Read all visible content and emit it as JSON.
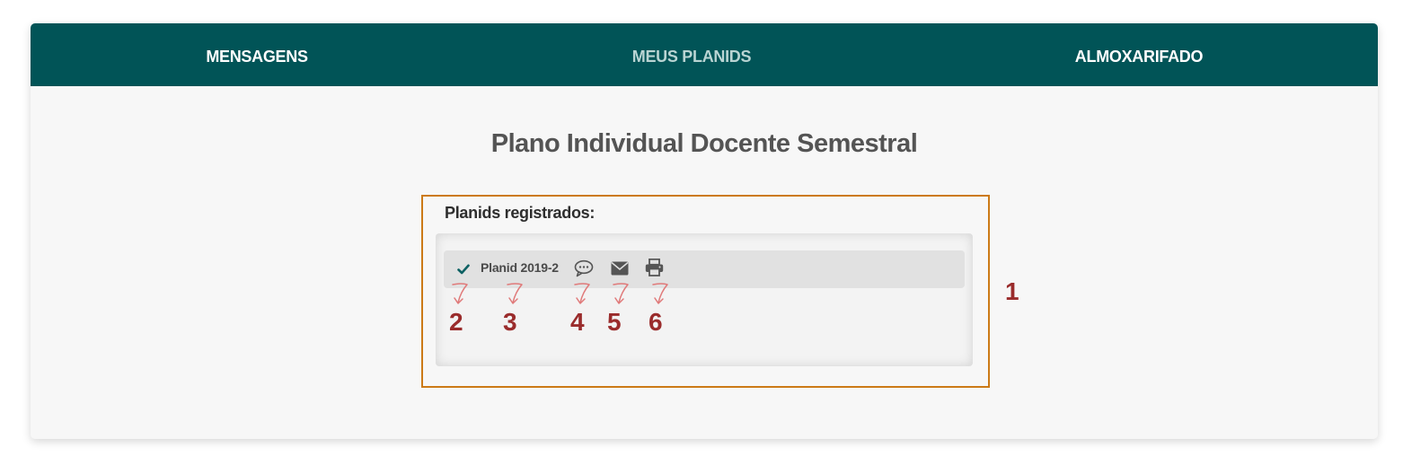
{
  "nav": {
    "items": [
      {
        "label": "MENSAGENS"
      },
      {
        "label": "MEUS PLANIDS"
      },
      {
        "label": "ALMOXARIFADO"
      }
    ],
    "active_index": 1,
    "background_color": "#015457",
    "text_color": "#ffffff",
    "active_text_color": "#b9d4d3"
  },
  "page": {
    "title": "Plano Individual Docente Semestral"
  },
  "planids": {
    "section_label": "Planids registrados:",
    "items": [
      {
        "status_icon": "check-icon",
        "label": "Planid 2019-2",
        "actions": [
          "comment-icon",
          "mail-icon",
          "print-icon"
        ]
      }
    ]
  },
  "annotations": {
    "highlight_color": "#cc7a17",
    "number_color": "#9a2c2c",
    "arrow_color": "#e07a7a",
    "labels": [
      "1",
      "2",
      "3",
      "4",
      "5",
      "6"
    ]
  }
}
